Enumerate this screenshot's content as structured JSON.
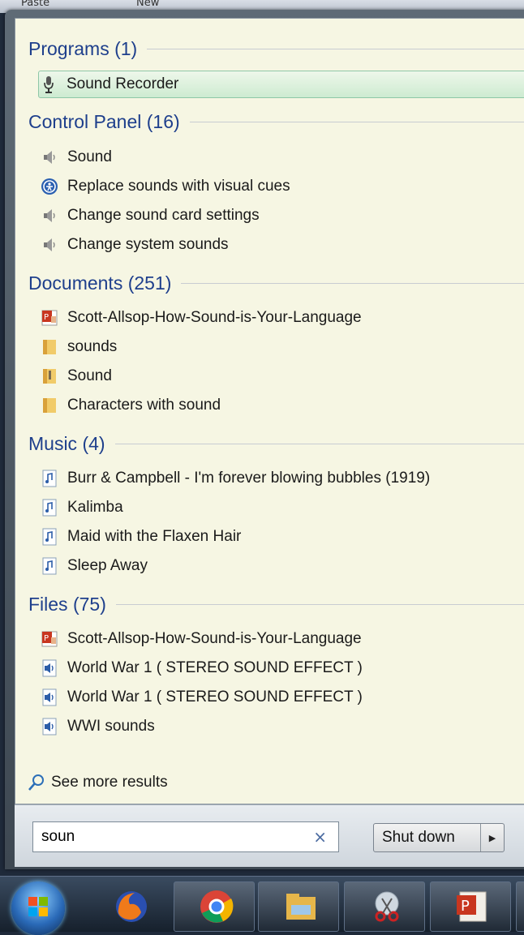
{
  "top_strip": {
    "left_text": "Paste",
    "mid_text": "New"
  },
  "groups": [
    {
      "header": "Programs (1)",
      "items": [
        {
          "label": "Sound Recorder",
          "icon": "microphone-icon",
          "selected": true
        }
      ]
    },
    {
      "header": "Control Panel (16)",
      "items": [
        {
          "label": "Sound",
          "icon": "speaker-icon"
        },
        {
          "label": "Replace sounds with visual cues",
          "icon": "ease-of-access-icon"
        },
        {
          "label": "Change sound card settings",
          "icon": "speaker-icon"
        },
        {
          "label": "Change system sounds",
          "icon": "speaker-icon"
        }
      ]
    },
    {
      "header": "Documents (251)",
      "items": [
        {
          "label": "Scott-Allsop-How-Sound-is-Your-Language",
          "icon": "powerpoint-doc-icon"
        },
        {
          "label": "sounds",
          "icon": "folder-icon"
        },
        {
          "label": "Sound",
          "icon": "zip-folder-icon"
        },
        {
          "label": "Characters with sound",
          "icon": "folder-icon"
        }
      ]
    },
    {
      "header": "Music (4)",
      "items": [
        {
          "label": "Burr & Campbell - I'm forever blowing bubbles (1919)",
          "icon": "music-file-icon"
        },
        {
          "label": "Kalimba",
          "icon": "music-file-icon"
        },
        {
          "label": "Maid with the Flaxen Hair",
          "icon": "music-file-icon"
        },
        {
          "label": "Sleep Away",
          "icon": "music-file-icon"
        }
      ]
    },
    {
      "header": "Files (75)",
      "items": [
        {
          "label": "Scott-Allsop-How-Sound-is-Your-Language",
          "icon": "powerpoint-doc-icon"
        },
        {
          "label": "World War 1 ( STEREO SOUND EFFECT )",
          "icon": "audio-file-icon"
        },
        {
          "label": "World War 1 ( STEREO SOUND EFFECT )",
          "icon": "audio-file-icon"
        },
        {
          "label": "WWI sounds",
          "icon": "audio-file-icon"
        }
      ]
    }
  ],
  "see_more": {
    "label": "See more results"
  },
  "search": {
    "value": "soun",
    "clear_symbol": "×"
  },
  "shutdown": {
    "label": "Shut down"
  },
  "taskbar": [
    "firefox-icon",
    "chrome-icon",
    "file-explorer-icon",
    "snipping-tool-icon",
    "powerpoint-icon"
  ],
  "colors": {
    "header": "#1e3f8c",
    "panel": "#f6f6e3",
    "selected_border": "#8ec7a7"
  }
}
